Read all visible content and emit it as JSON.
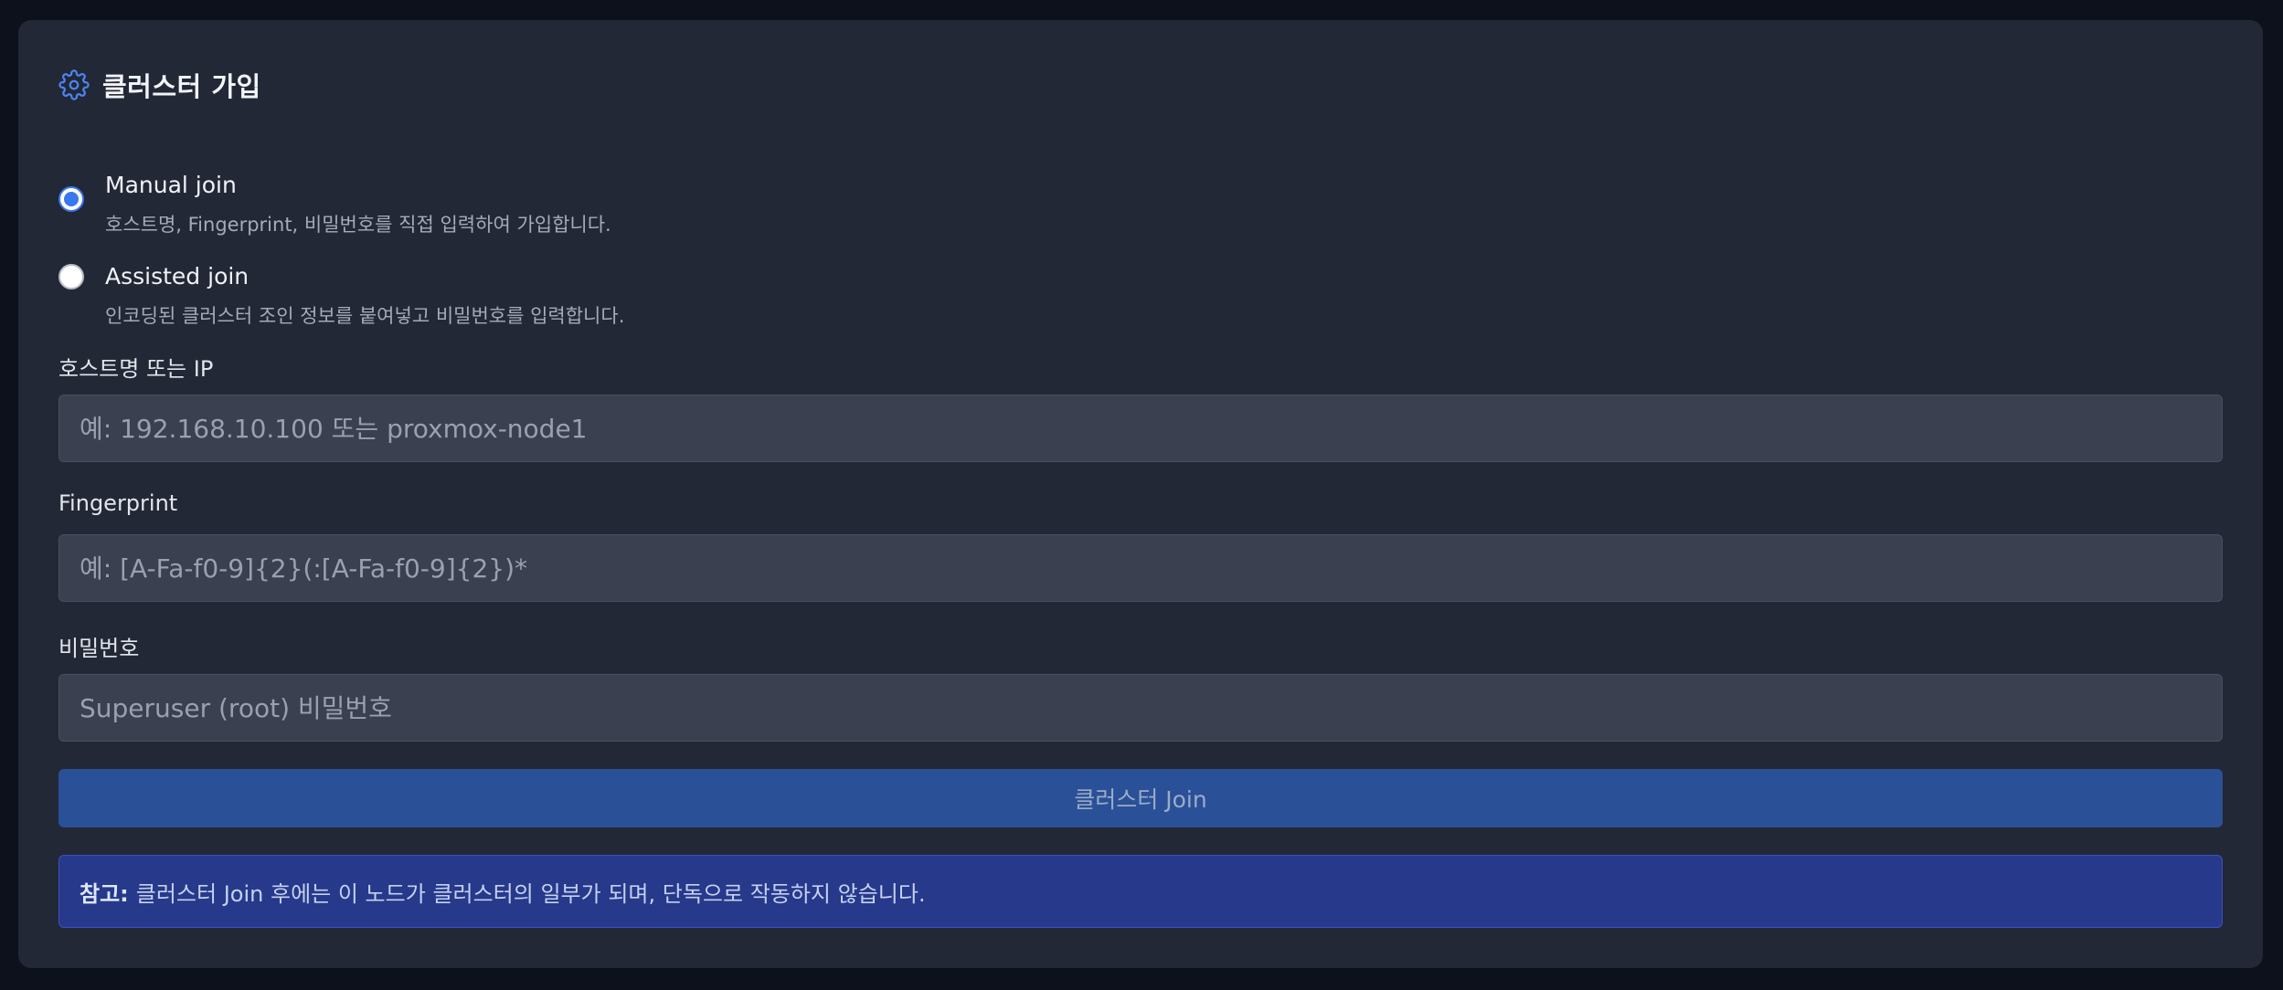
{
  "title": "클러스터 가입",
  "options": [
    {
      "label": "Manual join",
      "description": "호스트명, Fingerprint, 비밀번호를 직접 입력하여 가입합니다.",
      "checked": true
    },
    {
      "label": "Assisted join",
      "description": "인코딩된 클러스터 조인 정보를 붙여넣고 비밀번호를 입력합니다.",
      "checked": false
    }
  ],
  "fields": {
    "host": {
      "label": "호스트명 또는 IP",
      "placeholder": "예: 192.168.10.100 또는 proxmox-node1",
      "value": ""
    },
    "fingerprint": {
      "label": "Fingerprint",
      "placeholder": "예: [A-Fa-f0-9]{2}(:[A-Fa-f0-9]{2})*",
      "value": ""
    },
    "password": {
      "label": "비밀번호",
      "placeholder": "Superuser (root) 비밀번호",
      "value": ""
    }
  },
  "join_button": "클러스터 Join",
  "note": {
    "prefix": "참고:",
    "text": "클러스터 Join 후에는 이 노드가 클러스터의 일부가 되며, 단독으로 작동하지 않습니다."
  },
  "colors": {
    "accent": "#3a76ec",
    "background": "#222836",
    "button": "#2a5097",
    "note": "#26398a"
  },
  "icons": {
    "title": "gear-icon"
  }
}
